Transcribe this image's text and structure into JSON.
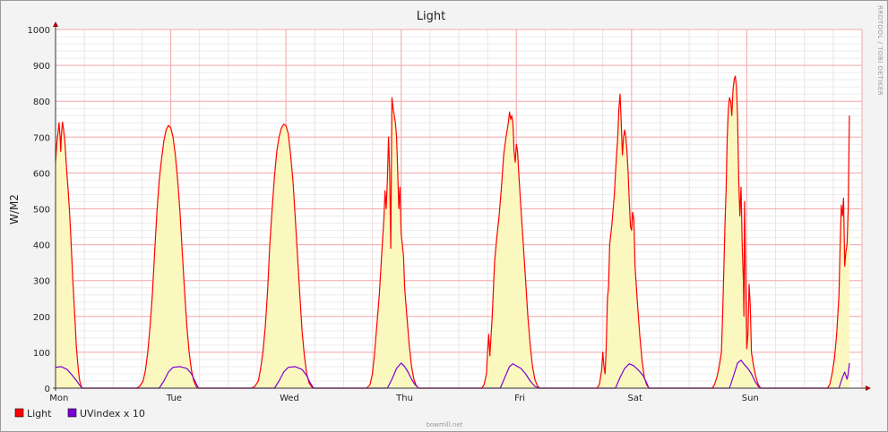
{
  "chart_data": {
    "type": "area",
    "title": "Light",
    "ylabel": "W/M2",
    "xlabel": "",
    "ylim": [
      0,
      1000
    ],
    "yticks": [
      0,
      100,
      200,
      300,
      400,
      500,
      600,
      700,
      800,
      900,
      1000
    ],
    "x_range_days": [
      0,
      7
    ],
    "categories": [
      "Mon",
      "Tue",
      "Wed",
      "Thu",
      "Fri",
      "Sat",
      "Sun"
    ],
    "grid": true,
    "legend_position": "bottom-left",
    "series": [
      {
        "name": "Light",
        "color": "#ff0000",
        "fill": "#fbf8bf",
        "points": [
          [
            0.0,
            630
          ],
          [
            0.01,
            680
          ],
          [
            0.02,
            710
          ],
          [
            0.03,
            740
          ],
          [
            0.04,
            700
          ],
          [
            0.045,
            660
          ],
          [
            0.05,
            700
          ],
          [
            0.06,
            742
          ],
          [
            0.07,
            720
          ],
          [
            0.08,
            690
          ],
          [
            0.09,
            640
          ],
          [
            0.1,
            590
          ],
          [
            0.11,
            550
          ],
          [
            0.12,
            500
          ],
          [
            0.13,
            440
          ],
          [
            0.14,
            370
          ],
          [
            0.15,
            300
          ],
          [
            0.16,
            240
          ],
          [
            0.17,
            180
          ],
          [
            0.18,
            120
          ],
          [
            0.19,
            80
          ],
          [
            0.2,
            45
          ],
          [
            0.21,
            20
          ],
          [
            0.22,
            8
          ],
          [
            0.23,
            0
          ],
          [
            0.7,
            0
          ],
          [
            0.73,
            5
          ],
          [
            0.76,
            20
          ],
          [
            0.78,
            50
          ],
          [
            0.8,
            100
          ],
          [
            0.82,
            170
          ],
          [
            0.84,
            260
          ],
          [
            0.86,
            380
          ],
          [
            0.88,
            490
          ],
          [
            0.9,
            580
          ],
          [
            0.92,
            640
          ],
          [
            0.94,
            690
          ],
          [
            0.96,
            720
          ],
          [
            0.98,
            733
          ],
          [
            1.0,
            725
          ],
          [
            1.02,
            700
          ],
          [
            1.04,
            650
          ],
          [
            1.06,
            580
          ],
          [
            1.08,
            490
          ],
          [
            1.1,
            380
          ],
          [
            1.12,
            270
          ],
          [
            1.14,
            170
          ],
          [
            1.16,
            100
          ],
          [
            1.18,
            50
          ],
          [
            1.2,
            20
          ],
          [
            1.22,
            5
          ],
          [
            1.24,
            0
          ],
          [
            1.7,
            0
          ],
          [
            1.73,
            5
          ],
          [
            1.76,
            20
          ],
          [
            1.78,
            55
          ],
          [
            1.8,
            100
          ],
          [
            1.82,
            170
          ],
          [
            1.84,
            270
          ],
          [
            1.86,
            400
          ],
          [
            1.88,
            500
          ],
          [
            1.9,
            590
          ],
          [
            1.92,
            660
          ],
          [
            1.94,
            700
          ],
          [
            1.96,
            725
          ],
          [
            1.98,
            736
          ],
          [
            2.0,
            732
          ],
          [
            2.02,
            710
          ],
          [
            2.04,
            650
          ],
          [
            2.06,
            580
          ],
          [
            2.08,
            480
          ],
          [
            2.1,
            370
          ],
          [
            2.12,
            260
          ],
          [
            2.14,
            160
          ],
          [
            2.16,
            90
          ],
          [
            2.18,
            40
          ],
          [
            2.2,
            15
          ],
          [
            2.22,
            5
          ],
          [
            2.24,
            0
          ],
          [
            2.7,
            0
          ],
          [
            2.73,
            10
          ],
          [
            2.75,
            40
          ],
          [
            2.77,
            100
          ],
          [
            2.79,
            180
          ],
          [
            2.81,
            260
          ],
          [
            2.83,
            370
          ],
          [
            2.84,
            420
          ],
          [
            2.85,
            470
          ],
          [
            2.86,
            550
          ],
          [
            2.87,
            500
          ],
          [
            2.88,
            580
          ],
          [
            2.89,
            700
          ],
          [
            2.9,
            600
          ],
          [
            2.91,
            390
          ],
          [
            2.92,
            810
          ],
          [
            2.93,
            780
          ],
          [
            2.94,
            760
          ],
          [
            2.95,
            740
          ],
          [
            2.96,
            700
          ],
          [
            2.97,
            600
          ],
          [
            2.98,
            500
          ],
          [
            2.99,
            560
          ],
          [
            3.0,
            430
          ],
          [
            3.01,
            400
          ],
          [
            3.02,
            370
          ],
          [
            3.03,
            280
          ],
          [
            3.05,
            200
          ],
          [
            3.07,
            120
          ],
          [
            3.09,
            60
          ],
          [
            3.11,
            25
          ],
          [
            3.13,
            8
          ],
          [
            3.15,
            0
          ],
          [
            3.7,
            0
          ],
          [
            3.72,
            10
          ],
          [
            3.74,
            40
          ],
          [
            3.75,
            100
          ],
          [
            3.76,
            150
          ],
          [
            3.77,
            90
          ],
          [
            3.79,
            200
          ],
          [
            3.81,
            350
          ],
          [
            3.83,
            420
          ],
          [
            3.85,
            480
          ],
          [
            3.87,
            560
          ],
          [
            3.89,
            650
          ],
          [
            3.91,
            700
          ],
          [
            3.93,
            740
          ],
          [
            3.94,
            770
          ],
          [
            3.95,
            750
          ],
          [
            3.96,
            760
          ],
          [
            3.97,
            740
          ],
          [
            3.98,
            660
          ],
          [
            3.99,
            630
          ],
          [
            4.0,
            680
          ],
          [
            4.01,
            660
          ],
          [
            4.02,
            600
          ],
          [
            4.04,
            500
          ],
          [
            4.06,
            400
          ],
          [
            4.08,
            300
          ],
          [
            4.1,
            200
          ],
          [
            4.12,
            120
          ],
          [
            4.14,
            60
          ],
          [
            4.16,
            25
          ],
          [
            4.18,
            8
          ],
          [
            4.2,
            0
          ],
          [
            4.7,
            0
          ],
          [
            4.72,
            10
          ],
          [
            4.74,
            50
          ],
          [
            4.75,
            100
          ],
          [
            4.76,
            60
          ],
          [
            4.77,
            40
          ],
          [
            4.78,
            120
          ],
          [
            4.79,
            250
          ],
          [
            4.8,
            280
          ],
          [
            4.81,
            400
          ],
          [
            4.83,
            460
          ],
          [
            4.84,
            500
          ],
          [
            4.85,
            540
          ],
          [
            4.86,
            600
          ],
          [
            4.87,
            650
          ],
          [
            4.88,
            700
          ],
          [
            4.89,
            780
          ],
          [
            4.9,
            820
          ],
          [
            4.91,
            740
          ],
          [
            4.92,
            650
          ],
          [
            4.93,
            700
          ],
          [
            4.94,
            720
          ],
          [
            4.95,
            700
          ],
          [
            4.96,
            660
          ],
          [
            4.97,
            600
          ],
          [
            4.98,
            520
          ],
          [
            4.99,
            450
          ],
          [
            5.0,
            440
          ],
          [
            5.01,
            490
          ],
          [
            5.02,
            470
          ],
          [
            5.03,
            340
          ],
          [
            5.05,
            240
          ],
          [
            5.07,
            150
          ],
          [
            5.09,
            80
          ],
          [
            5.11,
            30
          ],
          [
            5.13,
            10
          ],
          [
            5.15,
            0
          ],
          [
            5.7,
            0
          ],
          [
            5.72,
            10
          ],
          [
            5.74,
            30
          ],
          [
            5.76,
            60
          ],
          [
            5.78,
            100
          ],
          [
            5.79,
            200
          ],
          [
            5.8,
            320
          ],
          [
            5.81,
            450
          ],
          [
            5.82,
            550
          ],
          [
            5.83,
            700
          ],
          [
            5.84,
            780
          ],
          [
            5.85,
            810
          ],
          [
            5.86,
            800
          ],
          [
            5.87,
            760
          ],
          [
            5.88,
            830
          ],
          [
            5.89,
            860
          ],
          [
            5.9,
            870
          ],
          [
            5.91,
            840
          ],
          [
            5.92,
            760
          ],
          [
            5.93,
            580
          ],
          [
            5.94,
            480
          ],
          [
            5.95,
            560
          ],
          [
            5.96,
            400
          ],
          [
            5.97,
            300
          ],
          [
            5.975,
            200
          ],
          [
            5.98,
            520
          ],
          [
            5.99,
            300
          ],
          [
            6.0,
            110
          ],
          [
            6.01,
            150
          ],
          [
            6.02,
            290
          ],
          [
            6.03,
            230
          ],
          [
            6.04,
            100
          ],
          [
            6.06,
            60
          ],
          [
            6.08,
            30
          ],
          [
            6.1,
            10
          ],
          [
            6.12,
            0
          ],
          [
            6.7,
            0
          ],
          [
            6.72,
            10
          ],
          [
            6.74,
            40
          ],
          [
            6.76,
            80
          ],
          [
            6.78,
            150
          ],
          [
            6.8,
            260
          ],
          [
            6.81,
            400
          ],
          [
            6.82,
            510
          ],
          [
            6.83,
            480
          ],
          [
            6.84,
            530
          ],
          [
            6.85,
            340
          ],
          [
            6.86,
            380
          ],
          [
            6.87,
            400
          ],
          [
            6.88,
            500
          ],
          [
            6.89,
            760
          ]
        ]
      },
      {
        "name": "UVindex x 10",
        "color": "#7b00d6",
        "points": [
          [
            0.0,
            58
          ],
          [
            0.05,
            60
          ],
          [
            0.1,
            52
          ],
          [
            0.14,
            38
          ],
          [
            0.18,
            22
          ],
          [
            0.21,
            8
          ],
          [
            0.23,
            0
          ],
          [
            0.9,
            0
          ],
          [
            0.94,
            20
          ],
          [
            0.98,
            45
          ],
          [
            1.02,
            58
          ],
          [
            1.08,
            60
          ],
          [
            1.14,
            55
          ],
          [
            1.18,
            40
          ],
          [
            1.21,
            20
          ],
          [
            1.24,
            0
          ],
          [
            1.9,
            0
          ],
          [
            1.94,
            20
          ],
          [
            1.98,
            45
          ],
          [
            2.02,
            58
          ],
          [
            2.08,
            60
          ],
          [
            2.14,
            52
          ],
          [
            2.18,
            35
          ],
          [
            2.21,
            15
          ],
          [
            2.24,
            0
          ],
          [
            2.88,
            0
          ],
          [
            2.92,
            25
          ],
          [
            2.96,
            55
          ],
          [
            3.0,
            70
          ],
          [
            3.03,
            60
          ],
          [
            3.06,
            45
          ],
          [
            3.09,
            25
          ],
          [
            3.12,
            10
          ],
          [
            3.15,
            0
          ],
          [
            3.86,
            0
          ],
          [
            3.9,
            30
          ],
          [
            3.94,
            60
          ],
          [
            3.97,
            68
          ],
          [
            4.0,
            62
          ],
          [
            4.04,
            55
          ],
          [
            4.08,
            40
          ],
          [
            4.12,
            20
          ],
          [
            4.16,
            5
          ],
          [
            4.2,
            0
          ],
          [
            4.86,
            0
          ],
          [
            4.9,
            30
          ],
          [
            4.94,
            55
          ],
          [
            4.98,
            68
          ],
          [
            5.02,
            62
          ],
          [
            5.06,
            50
          ],
          [
            5.1,
            35
          ],
          [
            5.13,
            15
          ],
          [
            5.15,
            0
          ],
          [
            5.85,
            0
          ],
          [
            5.89,
            40
          ],
          [
            5.92,
            70
          ],
          [
            5.95,
            78
          ],
          [
            5.98,
            65
          ],
          [
            6.01,
            55
          ],
          [
            6.04,
            40
          ],
          [
            6.07,
            20
          ],
          [
            6.1,
            5
          ],
          [
            6.12,
            0
          ],
          [
            6.8,
            0
          ],
          [
            6.83,
            30
          ],
          [
            6.85,
            45
          ],
          [
            6.86,
            35
          ],
          [
            6.87,
            25
          ],
          [
            6.88,
            40
          ],
          [
            6.89,
            70
          ]
        ]
      }
    ],
    "side_label": "RRDTOOL / TOBI OETIKER",
    "watermark": "bowmill.net"
  }
}
